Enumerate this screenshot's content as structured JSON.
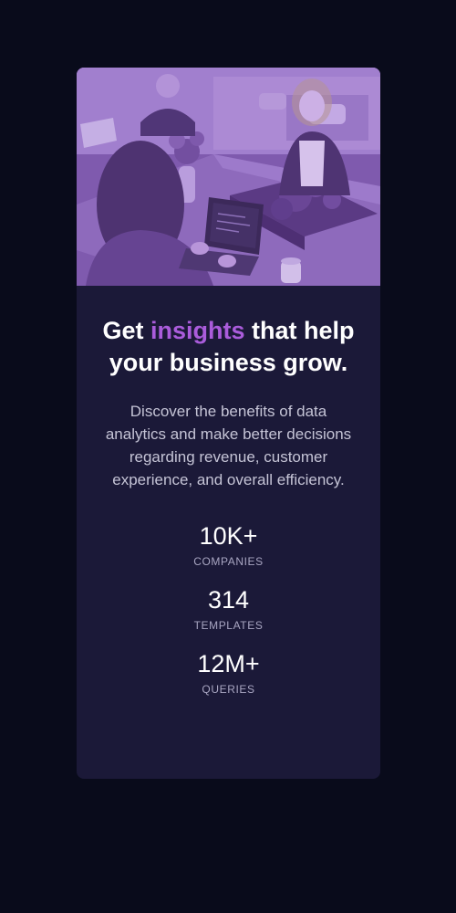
{
  "card": {
    "image_alt": "Team working with laptops at a shared office table",
    "headline": {
      "before": "Get ",
      "accent": "insights",
      "after": " that help your business grow."
    },
    "description": "Discover the benefits of data analytics and make better decisions regarding revenue, customer experience, and overall efficiency.",
    "stats": [
      {
        "value": "10K+",
        "label": "COMPANIES"
      },
      {
        "value": "314",
        "label": "TEMPLATES"
      },
      {
        "value": "12M+",
        "label": "QUERIES"
      }
    ]
  },
  "colors": {
    "page_background": "#090b1b",
    "card_background": "#1b1938",
    "accent": "#aa5cdb",
    "image_overlay": "#8d5cc6",
    "heading": "#ffffff",
    "body_text": "#c5c4d6",
    "stat_label": "#a9a6c2"
  }
}
